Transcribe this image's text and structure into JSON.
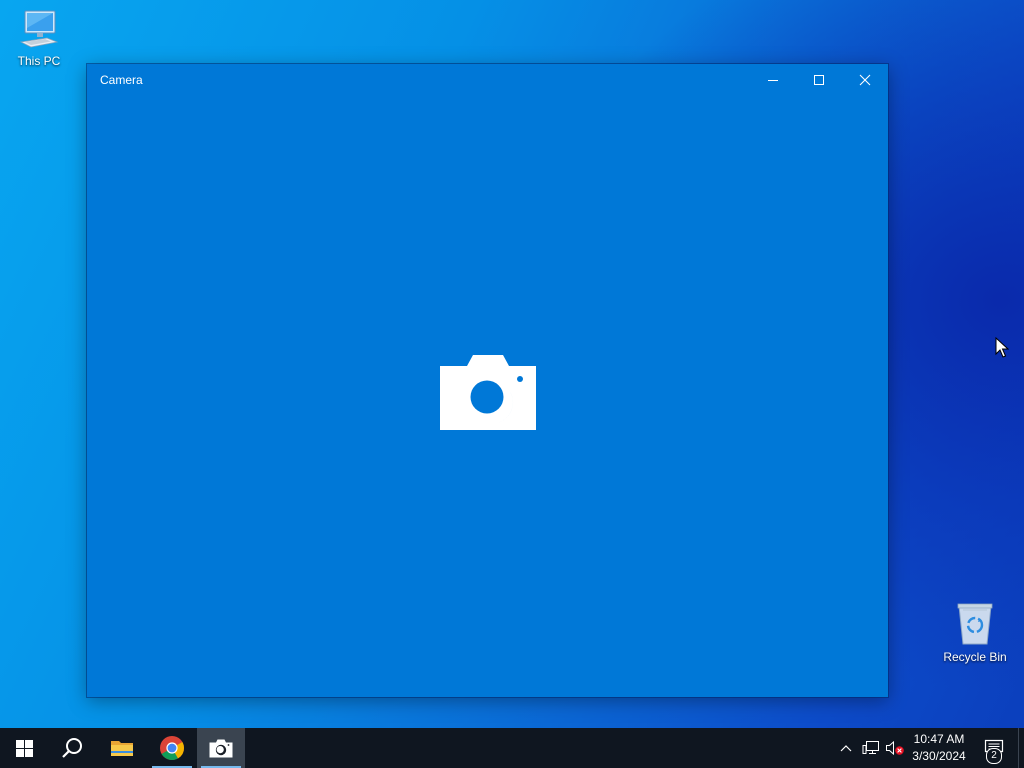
{
  "desktop": {
    "icons": [
      {
        "label": "This PC",
        "icon": "this-pc-icon"
      },
      {
        "label": "Recycle Bin",
        "icon": "recycle-bin-icon"
      }
    ]
  },
  "window": {
    "title": "Camera",
    "background_color": "#0078d7",
    "center_icon": "camera-icon",
    "controls": {
      "minimize": "minimize-icon",
      "maximize": "maximize-icon",
      "close": "close-icon"
    }
  },
  "taskbar": {
    "apps": [
      {
        "name": "Start",
        "icon": "windows-logo-icon"
      },
      {
        "name": "Search",
        "icon": "search-icon"
      },
      {
        "name": "File Explorer",
        "icon": "folder-icon"
      },
      {
        "name": "Google Chrome",
        "icon": "chrome-icon"
      },
      {
        "name": "Camera",
        "icon": "camera-icon",
        "active": true
      }
    ],
    "tray": {
      "chevron": "chevron-up-icon",
      "network": "network-icon",
      "volume": "volume-muted-icon",
      "time": "10:47 AM",
      "date": "3/30/2024",
      "notifications_count": "2"
    },
    "background_color": "#0f1620",
    "accent_color": "#76b9ed"
  }
}
